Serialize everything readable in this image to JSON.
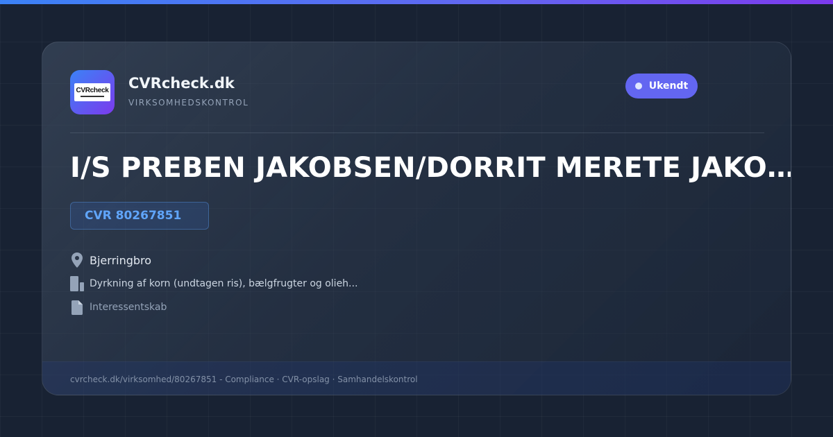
{
  "brand": {
    "name": "CVRcheck.dk",
    "tagline": "VIRKSOMHEDSKONTROL",
    "logo_text": "CVRcheck"
  },
  "status": {
    "label": "Ukendt",
    "color": "#6366f1"
  },
  "company": {
    "name": "I/S PREBEN JAKOBSEN/DORRIT MERETE JAKOBSEN",
    "cvr": "CVR 80267851",
    "city": "Bjerringbro",
    "industry": "Dyrkning af korn (undtagen ris), bælgfrugter og olieh...",
    "type": "Interessentskab"
  },
  "icons": {
    "city": "location-pin-icon",
    "industry": "building-icon",
    "type": "document-icon"
  },
  "footer": {
    "text": "cvrcheck.dk/virksomhed/80267851 - Compliance · CVR-opslag · Samhandelskontrol"
  },
  "colors": {
    "accent": "#6366f1",
    "cvr": "#60a5fa",
    "background": "#182233"
  }
}
